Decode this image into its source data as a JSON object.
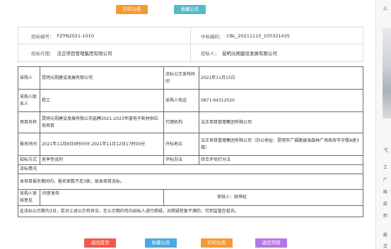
{
  "top_buttons": {
    "print": "打印公告",
    "collect": "收藏公告"
  },
  "info": {
    "bid_no_label": "招标编号：",
    "bid_no": "FZYN2021-1010",
    "win_no_label": "中标编码：",
    "win_no": "CBL_20211115_105321435",
    "agent_label": "招标代理：",
    "agent": "法正项目管理集团有限公司",
    "tenderer_label": "招标人：",
    "tenderer": "昆明元朔建设发展有限公司"
  },
  "detail": {
    "purchaser_label": "采购人",
    "purchaser": "昆明元朔建设发展有限公司",
    "pubtime_label": "流标公示发布时间",
    "pubtime": "2021年11月15日",
    "contact_label": "采购人联系人",
    "contact": "杨工",
    "phone_label": "采购人电话",
    "phone": "0871-64312020",
    "project_label": "项目名称",
    "project": "昆明元朔建设发展有限公司选聘2021-2023年度电子耗材供应商项目",
    "agency_label": "代理机构",
    "agency": "法正项目管理集团有限公司",
    "signup_label": "报名时间",
    "signup": "2021年11月8日9时00分-2021年11月12日17时00分",
    "place_label": "开标地点",
    "place": "法正项目管理集团有限公司（办公地址：昆明市广福路银海森林广场商务写字楼A座3楼）",
    "method_label": "招标方式",
    "method": "竞争性谈判",
    "eval_label": "评标办法",
    "eval": "综合评估打分法",
    "reason_label": "流标情况",
    "reason": "本项目报名期间内，报名家数不足3家，故本项目流标。",
    "opinion_label": "采购人审核意见",
    "opinion": "同意发布",
    "reviewer_label": "审核人：",
    "reviewer": "姚坤廷",
    "notice": "此流标公示期为3日，若对上述公示有异议，在公示期内可向招标人进行质疑，对质疑答复不满的，可到监管办投诉。"
  },
  "bottom_buttons": {
    "home": "返回首页",
    "collect": "收藏公告",
    "print": "打印公告",
    "top": "返回顶部"
  },
  "sidebar": {
    "frag_a": "A",
    "frag_b": "弋",
    "items": [
      "工",
      "广",
      "政",
      "给",
      "药"
    ],
    "frag_c": "能",
    "frag_d": "交"
  }
}
